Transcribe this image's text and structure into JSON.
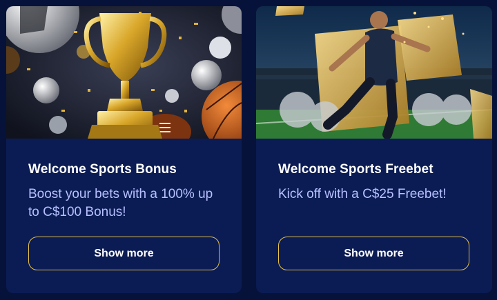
{
  "cards": [
    {
      "title": "Welcome Sports Bonus",
      "description": "Boost your bets with a 100% up to C$100 Bonus!",
      "button_label": "Show more",
      "image_icon": "trophy-icon"
    },
    {
      "title": "Welcome Sports Freebet",
      "description": "Kick off with a C$25 Freebet!",
      "button_label": "Show more",
      "image_icon": "soccer-player-icon"
    }
  ],
  "colors": {
    "page_bg": "#07123a",
    "card_bg": "#0b1c54",
    "title": "#ffffff",
    "description": "#b7c0ff",
    "button_border": "#e8c24a"
  }
}
